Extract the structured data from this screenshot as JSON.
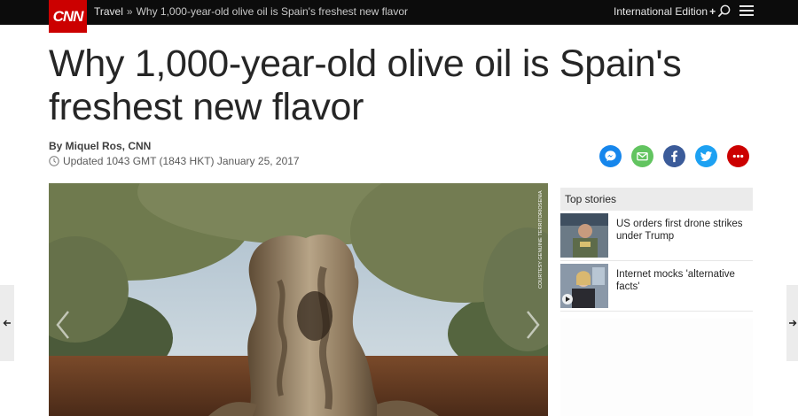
{
  "header": {
    "logo": "CNN",
    "breadcrumb_section": "Travel",
    "breadcrumb_sep": "»",
    "breadcrumb_current": "Why 1,000-year-old olive oil is Spain's freshest new flavor",
    "edition_label": "International Edition",
    "edition_plus": "+",
    "search_icon": "search-icon",
    "menu_icon": "hamburger-menu-icon"
  },
  "article": {
    "headline": "Why 1,000-year-old olive oil is Spain's freshest new flavor",
    "byline": "By Miquel Ros, CNN",
    "updated": "Updated 1043 GMT (1843 HKT) January 25, 2017",
    "image_credit": "COURTESY GENUINE TERRITORIOSENIA",
    "image_icon": "gallery-image"
  },
  "share": {
    "icons": [
      "messenger-icon",
      "email-icon",
      "facebook-icon",
      "twitter-icon",
      "more-icon"
    ],
    "colors": {
      "messenger": "#1686ec",
      "email": "#62c460",
      "facebook": "#3b5b99",
      "twitter": "#1da1f2",
      "more": "#cc0000"
    }
  },
  "sidebar": {
    "title": "Top stories",
    "stories": [
      {
        "title": "US orders first drone strikes under Trump"
      },
      {
        "title": "Internet mocks 'alternative facts'"
      }
    ]
  },
  "colors": {
    "brand": "#cc0000",
    "topbar": "#0c0c0c"
  }
}
